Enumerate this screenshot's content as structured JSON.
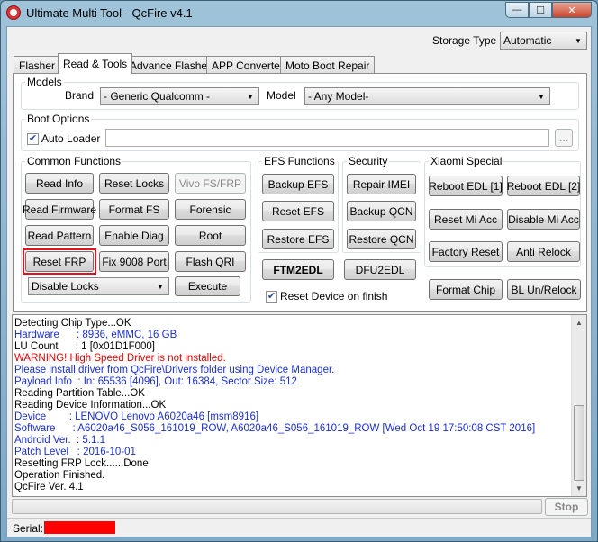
{
  "window": {
    "title": "Ultimate Multi Tool - QcFire v4.1",
    "minimize_glyph": "—",
    "maximize_glyph": "☐",
    "close_glyph": "✕"
  },
  "storage": {
    "label": "Storage Type",
    "value": "Automatic"
  },
  "tabs": [
    {
      "label": "Flasher"
    },
    {
      "label": "Read & Tools",
      "active": true
    },
    {
      "label": "Advance Flasher"
    },
    {
      "label": "APP Converter"
    },
    {
      "label": "Moto Boot Repair"
    }
  ],
  "models": {
    "title": "Models",
    "brand_label": "Brand",
    "brand_value": "- Generic Qualcomm -",
    "model_label": "Model",
    "model_value": "- Any Model-"
  },
  "boot_options": {
    "title": "Boot Options",
    "auto_loader_label": "Auto Loader",
    "auto_loader_checked": true,
    "loader_path": "",
    "browse_label": "..."
  },
  "common_functions": {
    "title": "Common Functions",
    "read_info": "Read Info",
    "reset_locks": "Reset Locks",
    "vivo_fs_frp": "Vivo FS/FRP",
    "read_firmware": "Read Firmware",
    "format_fs": "Format FS",
    "forensic": "Forensic",
    "read_pattern": "Read Pattern",
    "enable_diag": "Enable Diag",
    "root": "Root",
    "reset_frp": "Reset FRP",
    "fix_9008_port": "Fix 9008 Port",
    "flash_qri": "Flash QRI",
    "locks_select": "Disable Locks",
    "execute": "Execute"
  },
  "efs_functions": {
    "title": "EFS Functions",
    "backup_efs": "Backup EFS",
    "reset_efs": "Reset EFS",
    "restore_efs": "Restore EFS",
    "ftm2edl": "FTM2EDL"
  },
  "security": {
    "title": "Security",
    "repair_imei": "Repair IMEI",
    "backup_qcn": "Backup QCN",
    "restore_qcn": "Restore QCN",
    "dfu2edl": "DFU2EDL"
  },
  "xiaomi": {
    "title": "Xiaomi Special",
    "reboot_edl_1": "Reboot EDL [1]",
    "reboot_edl_2": "Reboot EDL [2]",
    "reset_mi_acc": "Reset Mi Acc",
    "disable_mi_acc": "Disable Mi Acc",
    "factory_reset": "Factory Reset",
    "anti_relock": "Anti Relock"
  },
  "reset_device_on_finish": {
    "label": "Reset Device on finish",
    "checked": true
  },
  "format_chip": "Format Chip",
  "bl_unrelock": "BL Un/Relock",
  "log": [
    {
      "text": "Detecting Chip Type...OK",
      "color": "black"
    },
    {
      "text": "Hardware      : 8936, eMMC, 16 GB",
      "color": "blue"
    },
    {
      "text": "LU Count      : 1 [0x01D1F000]",
      "color": "black"
    },
    {
      "text": "WARNING! High Speed Driver is not installed.",
      "color": "red"
    },
    {
      "text": "Please install driver from QcFire\\Drivers folder using Device Manager.",
      "color": "blue"
    },
    {
      "text": "Payload Info  : In: 65536 [4096], Out: 16384, Sector Size: 512",
      "color": "blue"
    },
    {
      "text": "Reading Partition Table...OK",
      "color": "black"
    },
    {
      "text": "Reading Device Information...OK",
      "color": "black"
    },
    {
      "text": "Device        : LENOVO Lenovo A6020a46 [msm8916]",
      "color": "blue"
    },
    {
      "text": "Software      : A6020a46_S056_161019_ROW, A6020a46_S056_161019_ROW [Wed Oct 19 17:50:08 CST 2016]",
      "color": "blue"
    },
    {
      "text": "Android Ver.  : 5.1.1",
      "color": "blue"
    },
    {
      "text": "Patch Level   : 2016-10-01",
      "color": "blue"
    },
    {
      "text": "Resetting FRP Lock......Done",
      "color": "black"
    },
    {
      "text": "Operation Finished.",
      "color": "black"
    },
    {
      "text": "QcFire Ver. 4.1",
      "color": "black"
    }
  ],
  "progress": {
    "fraction": 0.0
  },
  "stop_label": "Stop",
  "status": {
    "serial_label": "Serial:"
  }
}
